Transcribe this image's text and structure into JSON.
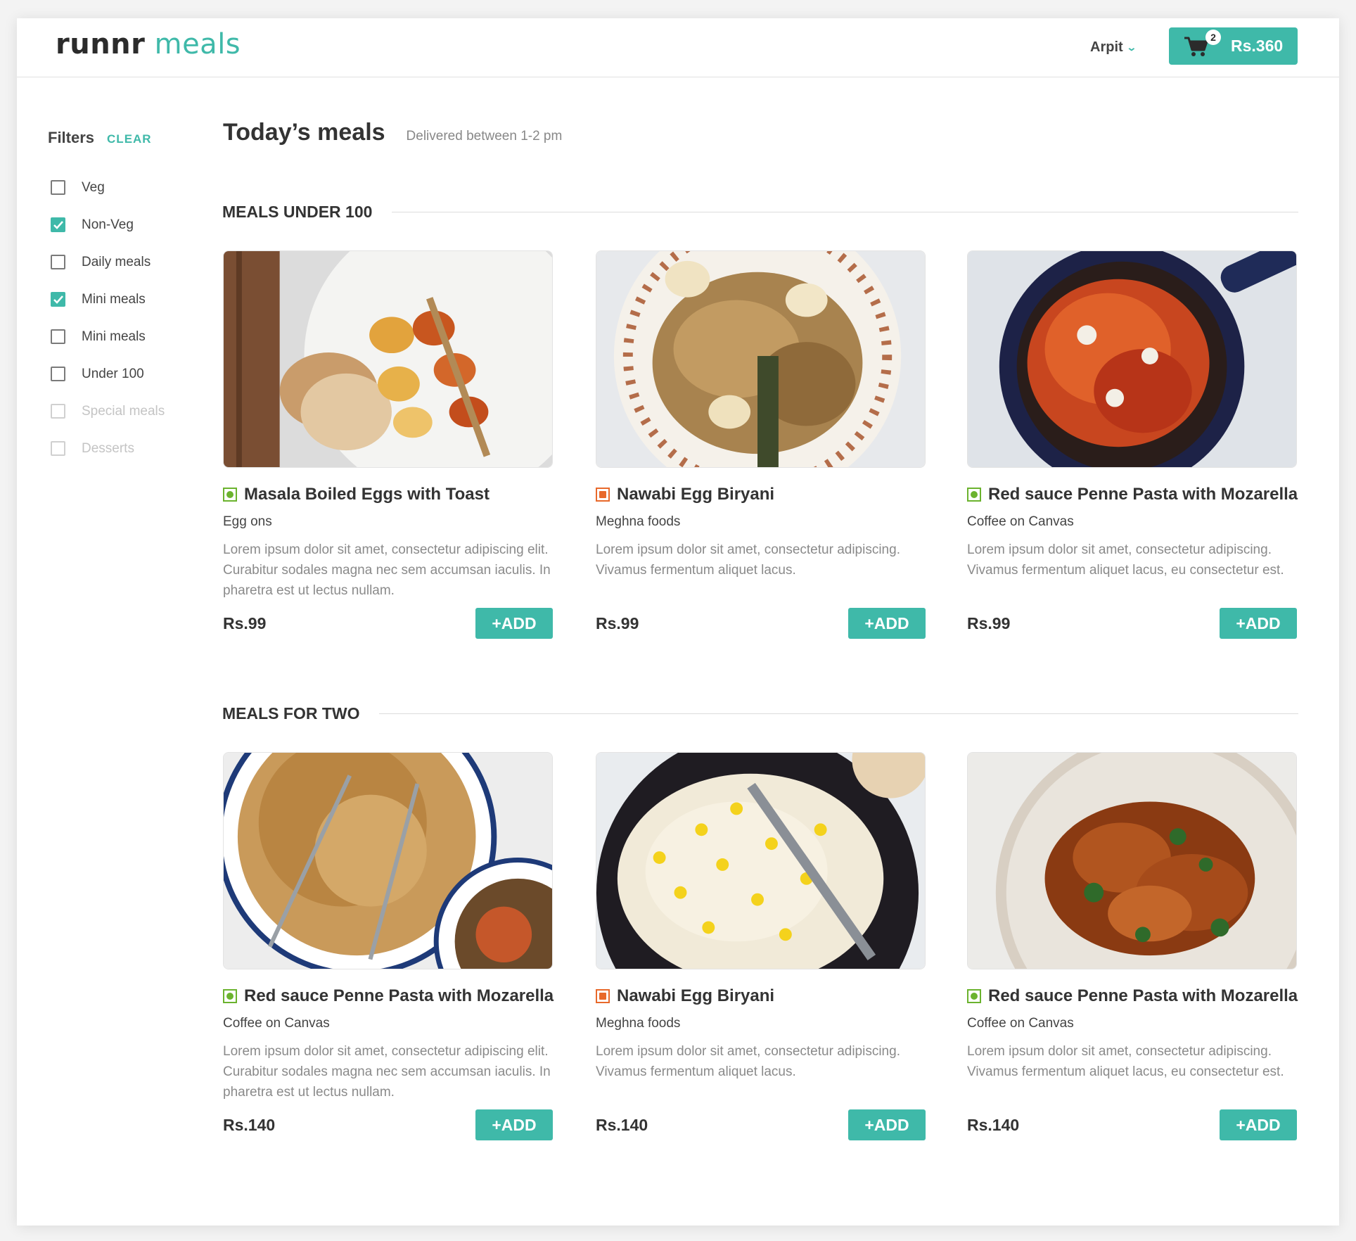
{
  "header": {
    "logo_main": "runnr",
    "logo_sub": "meals",
    "user_name": "Arpit",
    "cart_count": "2",
    "cart_total": "Rs.360"
  },
  "filters": {
    "title": "Filters",
    "clear_label": "CLEAR",
    "items": [
      {
        "label": "Veg",
        "checked": false,
        "disabled": false
      },
      {
        "label": "Non-Veg",
        "checked": true,
        "disabled": false
      },
      {
        "label": "Daily meals",
        "checked": false,
        "disabled": false
      },
      {
        "label": "Mini meals",
        "checked": true,
        "disabled": false
      },
      {
        "label": "Mini meals",
        "checked": false,
        "disabled": false
      },
      {
        "label": "Under 100",
        "checked": false,
        "disabled": false
      },
      {
        "label": "Special meals",
        "checked": false,
        "disabled": true
      },
      {
        "label": "Desserts",
        "checked": false,
        "disabled": true
      }
    ]
  },
  "page": {
    "title": "Today’s meals",
    "subtitle": "Delivered between 1-2 pm"
  },
  "sections": [
    {
      "title": "MEALS UNDER 100",
      "cards": [
        {
          "name": "Masala Boiled Eggs with Toast",
          "type": "veg",
          "vendor": "Egg ons",
          "desc": "Lorem ipsum dolor sit amet, consectetur adipiscing elit. Curabitur sodales magna nec sem accumsan iaculis. In pharetra est ut lectus nullam.",
          "price": "Rs.99",
          "add_label": "+ADD"
        },
        {
          "name": "Nawabi Egg Biryani",
          "type": "nonveg",
          "vendor": "Meghna foods",
          "desc": "Lorem ipsum dolor sit amet, consectetur adipiscing. Vivamus fermentum aliquet lacus.",
          "price": "Rs.99",
          "add_label": "+ADD"
        },
        {
          "name": "Red sauce Penne Pasta with Mozarella",
          "type": "veg",
          "vendor": "Coffee on Canvas",
          "desc": "Lorem ipsum dolor sit amet, consectetur adipiscing. Vivamus fermentum aliquet lacus, eu consectetur est.",
          "price": "Rs.99",
          "add_label": "+ADD"
        }
      ]
    },
    {
      "title": "MEALS FOR TWO",
      "cards": [
        {
          "name": "Red sauce Penne Pasta with Mozarella",
          "type": "veg",
          "vendor": "Coffee on Canvas",
          "desc": "Lorem ipsum dolor sit amet, consectetur adipiscing elit. Curabitur sodales magna nec sem accumsan iaculis. In pharetra est ut lectus nullam.",
          "price": "Rs.140",
          "add_label": "+ADD"
        },
        {
          "name": "Nawabi Egg Biryani",
          "type": "nonveg",
          "vendor": "Meghna foods",
          "desc": "Lorem ipsum dolor sit amet, consectetur adipiscing. Vivamus fermentum aliquet lacus.",
          "price": "Rs.140",
          "add_label": "+ADD"
        },
        {
          "name": "Red sauce Penne Pasta with Mozarella",
          "type": "veg",
          "vendor": "Coffee on Canvas",
          "desc": "Lorem ipsum dolor sit amet, consectetur adipiscing. Vivamus fermentum aliquet lacus, eu consectetur est.",
          "price": "Rs.140",
          "add_label": "+ADD"
        }
      ]
    }
  ],
  "colors": {
    "accent": "#3fb9a9",
    "veg": "#6bb32e",
    "nonveg": "#e8692b"
  }
}
